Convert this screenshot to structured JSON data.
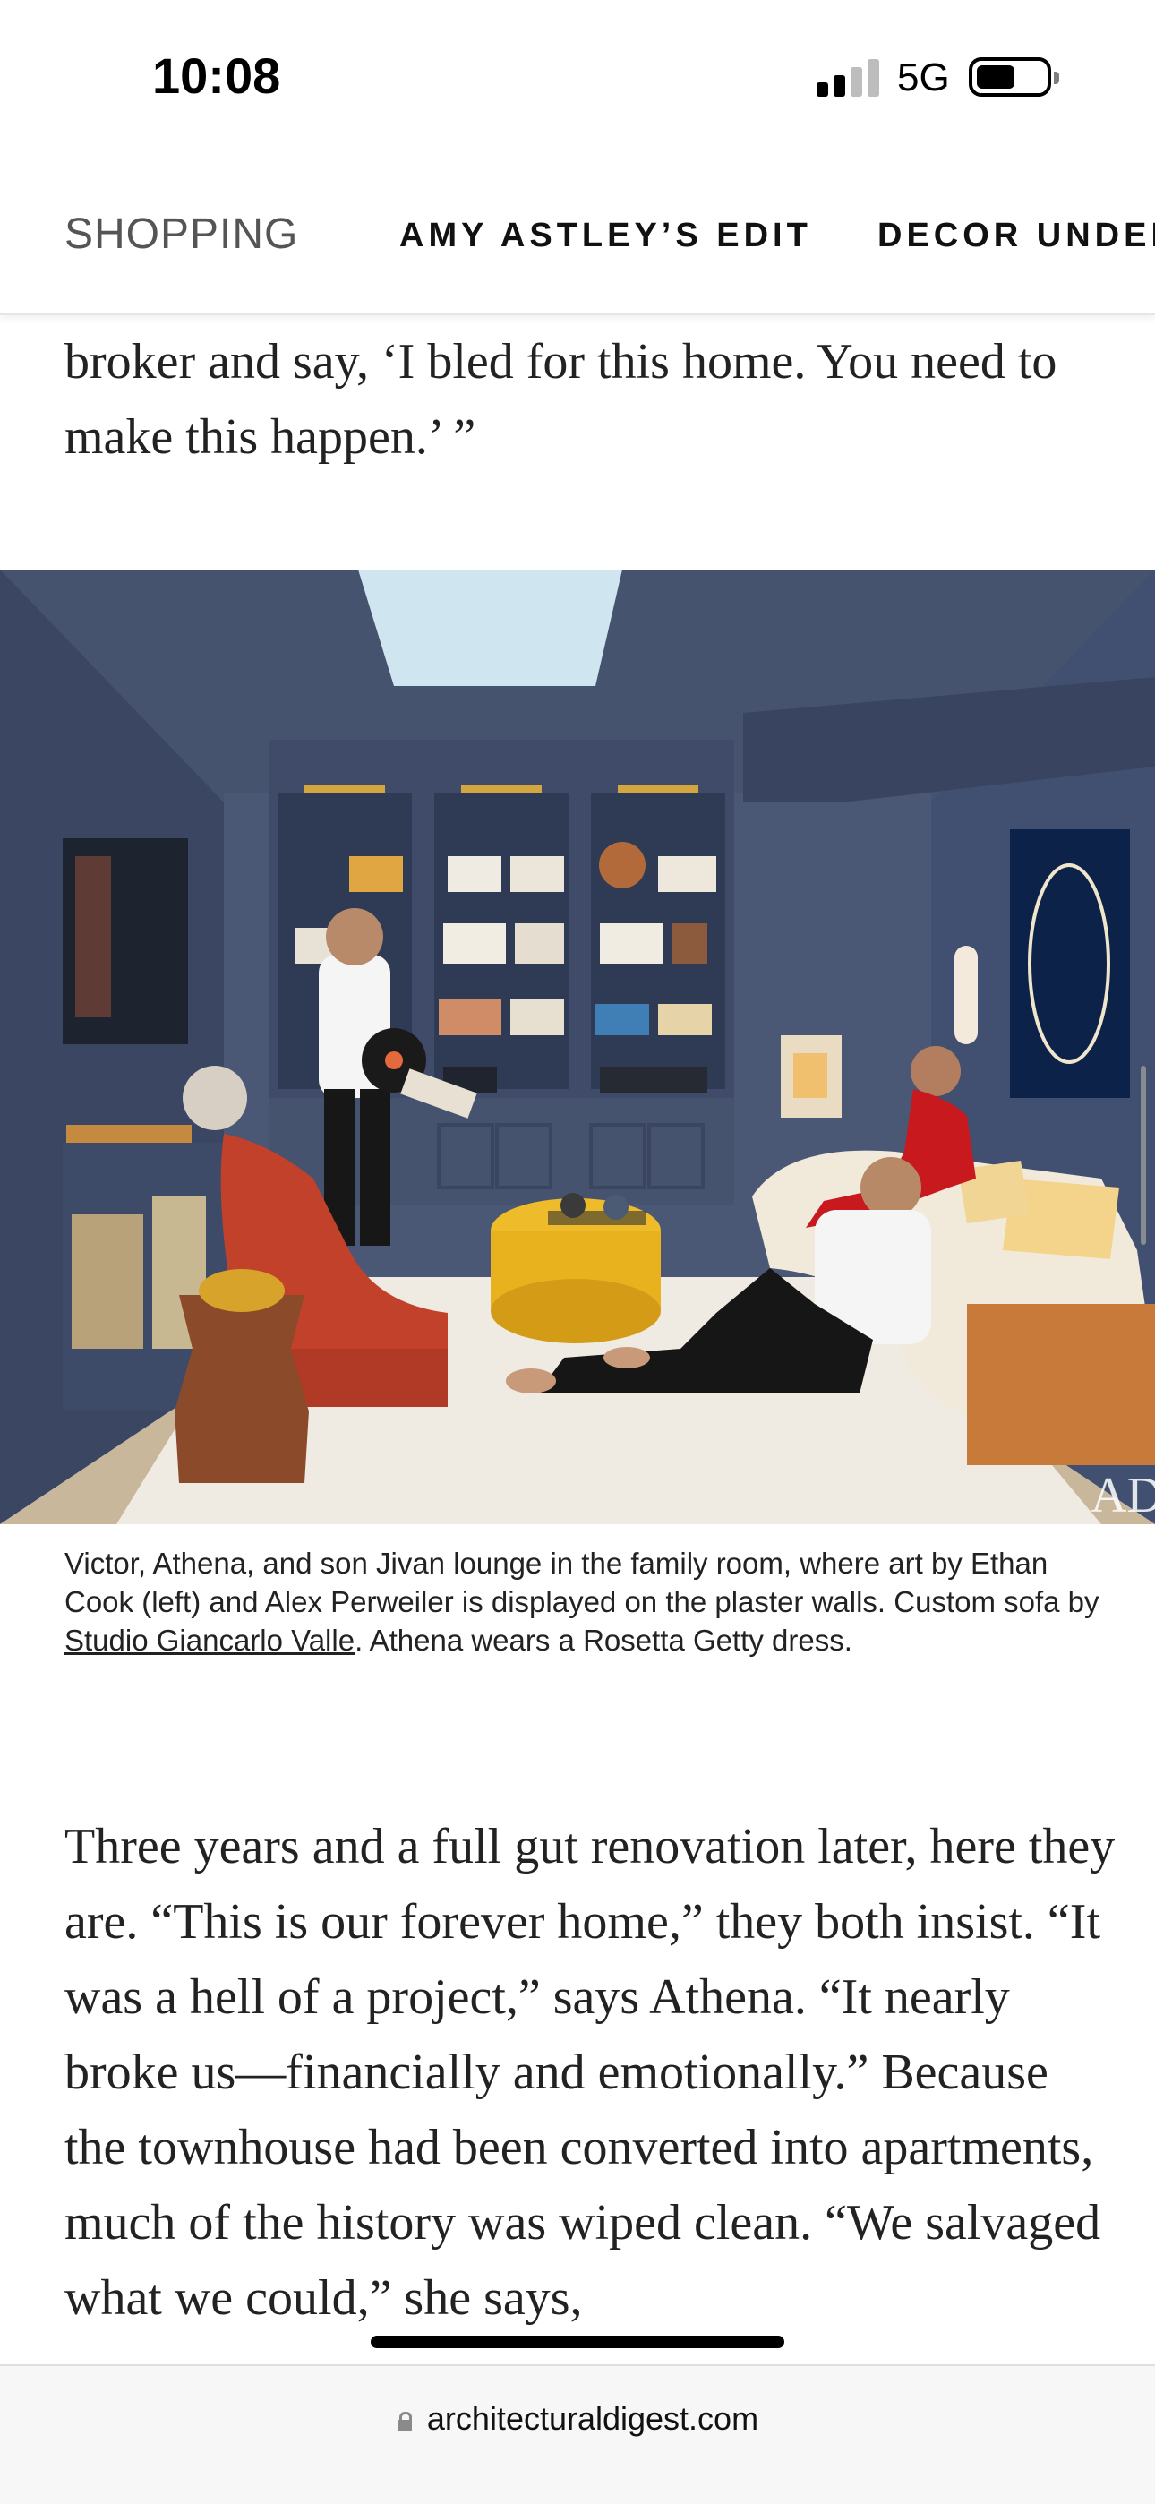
{
  "status_bar": {
    "time": "10:08",
    "network": "5G",
    "icons": [
      "signal-bars-icon",
      "battery-icon"
    ]
  },
  "nav": {
    "items": [
      {
        "label": "SHOPPING"
      },
      {
        "label": "AMY ASTLEY’S EDIT"
      },
      {
        "label": "DECOR UNDER"
      }
    ]
  },
  "article": {
    "para_top": "broker and say, ‘I bled for this home. You need to make this happen.’ ”",
    "photo_watermark": "AD",
    "caption": {
      "before_link": "Victor, Athena, and son Jivan lounge in the family room, where art by Ethan Cook (left) and Alex Perweiler is displayed on the plaster walls. Custom sofa by ",
      "link": "Studio Giancarlo Valle",
      "after_link": ". Athena wears a Rosetta Getty dress."
    },
    "para_main": "Three years and a full gut renovation later, here they are. “This is our forever home,” they both insist. “It was a hell of a project,” says Athena. “It nearly broke us—financially and emotionally.” Because the townhouse had been converted into apartments, much of the history was wiped clean. “We salvaged what we could,” she says,"
  },
  "browser": {
    "url": "architecturaldigest.com"
  },
  "colors": {
    "wall": "#4a5775",
    "rug": "#efeae2",
    "ottoman": "#e8b21f",
    "armchair": "#c2412b",
    "sofa": "#f1e9da"
  }
}
